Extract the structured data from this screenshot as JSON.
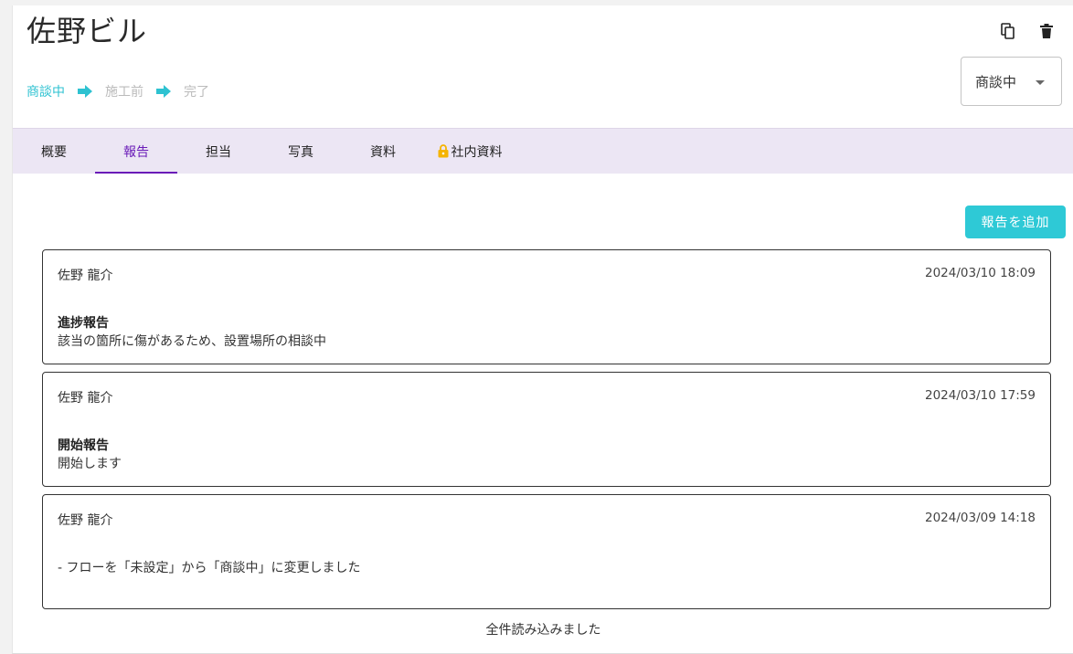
{
  "header": {
    "title": "佐野ビル",
    "copy_icon": "copy-icon",
    "delete_icon": "trash-icon"
  },
  "flow": {
    "steps": [
      {
        "label": "商談中",
        "active": true
      },
      {
        "label": "施工前",
        "active": false
      },
      {
        "label": "完了",
        "active": false
      }
    ]
  },
  "status_select": {
    "value": "商談中"
  },
  "tabs": [
    {
      "label": "概要"
    },
    {
      "label": "報告"
    },
    {
      "label": "担当"
    },
    {
      "label": "写真"
    },
    {
      "label": "資料"
    },
    {
      "label": "社内資料"
    }
  ],
  "add_button": {
    "label": "報告を追加"
  },
  "reports": [
    {
      "author": "佐野 龍介",
      "timestamp": "2024/03/10 18:09",
      "title": "進捗報告",
      "body": "該当の箇所に傷があるため、設置場所の相談中"
    },
    {
      "author": "佐野 龍介",
      "timestamp": "2024/03/10 17:59",
      "title": "開始報告",
      "body": "開始します"
    },
    {
      "author": "佐野 龍介",
      "timestamp": "2024/03/09 14:18",
      "title": "",
      "body": "- フローを「未設定」から「商談中」に変更しました"
    }
  ],
  "footer": {
    "status_text": "全件読み込みました"
  },
  "colors": {
    "accent": "#2ec9d6",
    "tab_active": "#6a1bb8",
    "tab_bar": "#ece6f4",
    "lock": "#f5b400"
  }
}
